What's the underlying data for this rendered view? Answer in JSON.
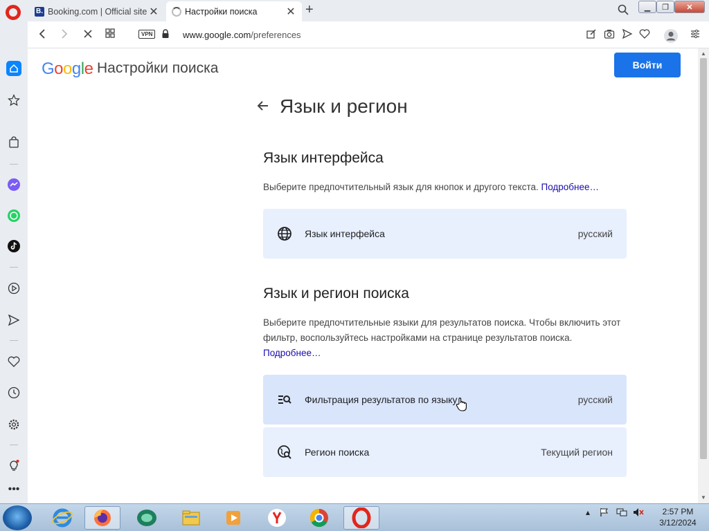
{
  "browser": {
    "tabs": [
      {
        "title": "Booking.com | Official site",
        "favicon": "B."
      },
      {
        "title": "Настройки поиска"
      }
    ],
    "vpn_label": "VPN",
    "url_host": "www.google.com",
    "url_path": "/preferences"
  },
  "header": {
    "logo_letters": [
      {
        "ch": "G",
        "color": "#4285F4"
      },
      {
        "ch": "o",
        "color": "#EA4335"
      },
      {
        "ch": "o",
        "color": "#FBBC05"
      },
      {
        "ch": "g",
        "color": "#4285F4"
      },
      {
        "ch": "l",
        "color": "#34A853"
      },
      {
        "ch": "e",
        "color": "#EA4335"
      }
    ],
    "title": "Настройки поиска",
    "signin_label": "Войти"
  },
  "main": {
    "section_title": "Язык и регион",
    "interface": {
      "heading": "Язык интерфейса",
      "description": "Выберите предпочтительный язык для кнопок и другого текста.",
      "more_link": "Подробнее…",
      "card_label": "Язык интерфейса",
      "card_value": "русский"
    },
    "search": {
      "heading": "Язык и регион поиска",
      "description": "Выберите предпочтительные языки для результатов поиска. Чтобы включить этот фильтр, воспользуйтесь настройками на странице результатов поиска.",
      "more_link": "Подробнее…",
      "filter_label": "Фильтрация результатов по языку",
      "filter_value": "русский",
      "region_label": "Регион поиска",
      "region_value": "Текущий регион"
    }
  },
  "taskbar": {
    "time": "2:57 PM",
    "date": "3/12/2024"
  },
  "colors": {
    "accent": "#1a73e8",
    "card_bg": "#e8f0fe",
    "link": "#1a0dab",
    "opera_red": "#e1261c"
  }
}
